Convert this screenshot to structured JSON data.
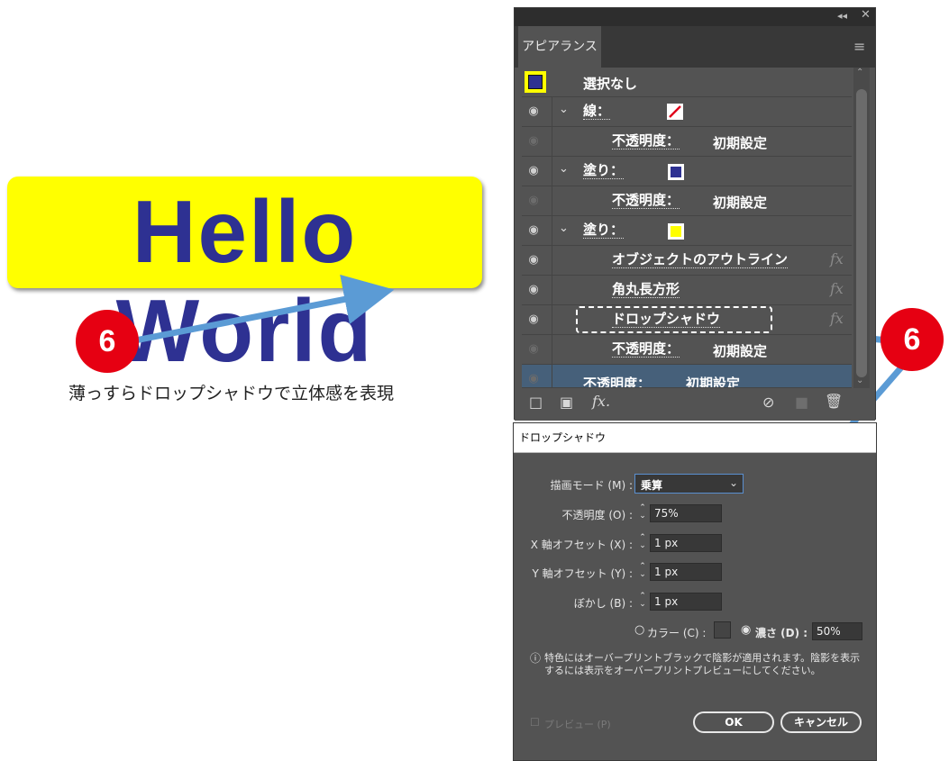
{
  "sample": {
    "text": "Hello World"
  },
  "callouts": {
    "left_number": "6",
    "right_number": "6",
    "caption": "薄っすらドロップシャドウで立体感を表現"
  },
  "appearance_panel": {
    "tab": "アピアランス",
    "rows": [
      {
        "label": "選択なし"
      },
      {
        "label": "線：",
        "swatch": "stroke-none"
      },
      {
        "label": "不透明度：",
        "value": "初期設定"
      },
      {
        "label": "塗り：",
        "swatch_color": "#2e3192"
      },
      {
        "label": "不透明度：",
        "value": "初期設定"
      },
      {
        "label": "塗り：",
        "swatch_color": "#ffff00"
      },
      {
        "label": "オブジェクトのアウトライン",
        "fx": "fx"
      },
      {
        "label": "角丸長方形",
        "fx": "fx"
      },
      {
        "label": "ドロップシャドウ",
        "fx": "fx"
      },
      {
        "label": "不透明度：",
        "value": "初期設定"
      },
      {
        "label": "不透明度：",
        "value": "初期設定"
      }
    ],
    "footer_fx": "fx."
  },
  "dropshadow_dialog": {
    "title": "ドロップシャドウ",
    "mode_label": "描画モード (M) :",
    "mode_value": "乗算",
    "opacity_label": "不透明度 (O) :",
    "opacity_value": "75%",
    "x_label": "X 軸オフセット (X) :",
    "x_value": "1 px",
    "y_label": "Y 軸オフセット (Y) :",
    "y_value": "1 px",
    "blur_label": "ぼかし (B) :",
    "blur_value": "1 px",
    "color_label": "カラー (C) :",
    "darkness_label": "濃さ (D) :",
    "darkness_value": "50%",
    "info_text": "特色にはオーバープリントブラックで陰影が適用されます。陰影を表示するには表示をオーバープリントプレビューにしてください。",
    "preview_label": "プレビュー (P)",
    "ok_label": "OK",
    "cancel_label": "キャンセル"
  },
  "colors": {
    "badge": "#e60012",
    "arrow": "#5b9bd5",
    "text_fill": "#2e3192",
    "bg_fill": "#ffff00"
  }
}
